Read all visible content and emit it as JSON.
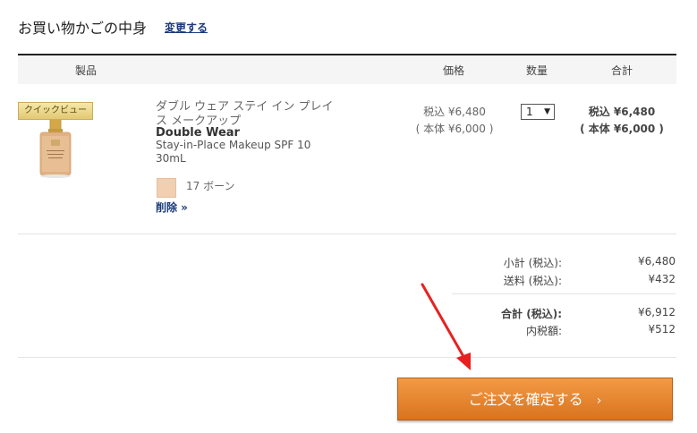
{
  "header": {
    "title": "お買い物かごの中身",
    "change_link": "変更する"
  },
  "table_headers": {
    "product": "製品",
    "price": "価格",
    "quantity": "数量",
    "total": "合計"
  },
  "item": {
    "quick_view": "クイックビュー",
    "name_jp": "ダブル ウェア ステイ イン プレイス メークアップ",
    "brand": "Double Wear",
    "name_en": "Stay-in-Place Makeup SPF 10",
    "size": "30mL",
    "shade_color": "#f3cfb2",
    "shade_name": "17 ボーン",
    "remove_link": "削除 »",
    "price_incl": "税込 ¥6,480",
    "price_excl": "( 本体 ¥6,000 )",
    "quantity": "1",
    "total_incl": "税込 ¥6,480",
    "total_excl": "( 本体 ¥6,000 )"
  },
  "summary": {
    "subtotal_label": "小計 (税込):",
    "subtotal_value": "¥6,480",
    "shipping_label": "送料 (税込):",
    "shipping_value": "¥432",
    "total_label": "合計 (税込):",
    "total_value": "¥6,912",
    "tax_label": "内税額:",
    "tax_value": "¥512"
  },
  "confirm_button": {
    "label": "ご注文を確定する",
    "chevron": "›"
  },
  "colors": {
    "accent": "#e8852e",
    "link": "#1a3a78",
    "arrow": "#e82020"
  }
}
